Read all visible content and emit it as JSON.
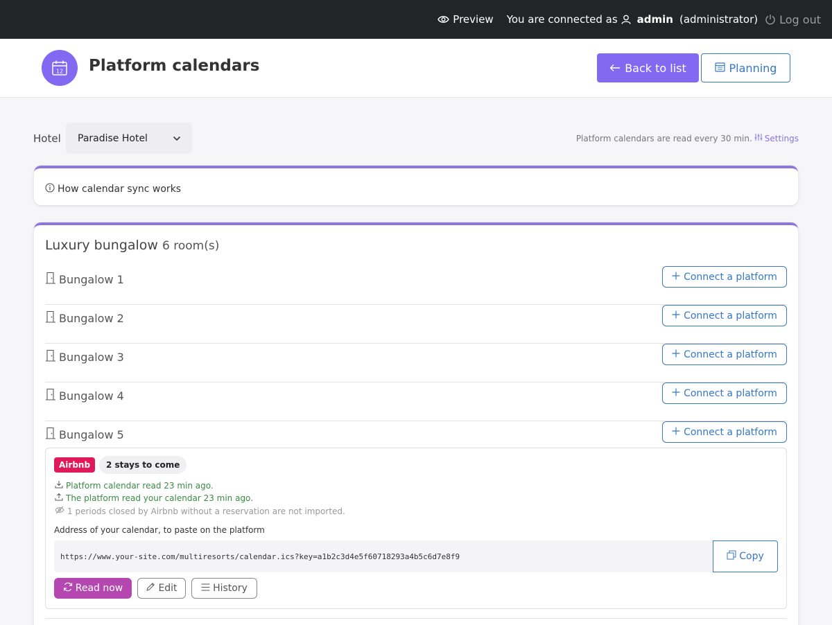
{
  "topbar": {
    "preview_label": "Preview",
    "connected_prefix": "You are connected as",
    "user_name": "admin",
    "user_role": "(administrator)",
    "logout_label": "Log out"
  },
  "header": {
    "title": "Platform calendars",
    "logo_day": "12",
    "back_label": "Back to list",
    "planning_label": "Planning"
  },
  "hotel": {
    "label": "Hotel",
    "selected": "Paradise Hotel",
    "read_note": "Platform calendars are read every 30 min.",
    "settings_label": "Settings"
  },
  "info": {
    "sync_label": "How calendar sync works"
  },
  "room_type": {
    "name": "Luxury bungalow",
    "count": "6 room(s)",
    "rooms": [
      {
        "name": "Bungalow 1",
        "button": "Connect a platform"
      },
      {
        "name": "Bungalow 2",
        "button": "Connect a platform"
      },
      {
        "name": "Bungalow 3",
        "button": "Connect a platform"
      },
      {
        "name": "Bungalow 4",
        "button": "Connect a platform"
      },
      {
        "name": "Bungalow 5",
        "button": "Connect a platform"
      }
    ]
  },
  "platform": {
    "badge": "Airbnb",
    "stays": "2 stays to come",
    "read_status": "Platform calendar read 23 min ago.",
    "export_status": "The platform read your calendar 23 min ago.",
    "closed_note": "1 periods closed by Airbnb without a reservation are not imported.",
    "address_label": "Address of your calendar, to paste on the platform",
    "url": "https://www.your-site.com/multiresorts/calendar.ics?key=a1b2c3d4e5f60718293a4b5c6d7e8f9",
    "copy_label": "Copy",
    "read_now_label": "Read now",
    "edit_label": "Edit",
    "history_label": "History"
  },
  "colors": {
    "accent": "#8169f2",
    "link": "#3577c8",
    "airbnb": "#e0195a",
    "read_now": "#b448b0",
    "success": "#3a8a46"
  }
}
